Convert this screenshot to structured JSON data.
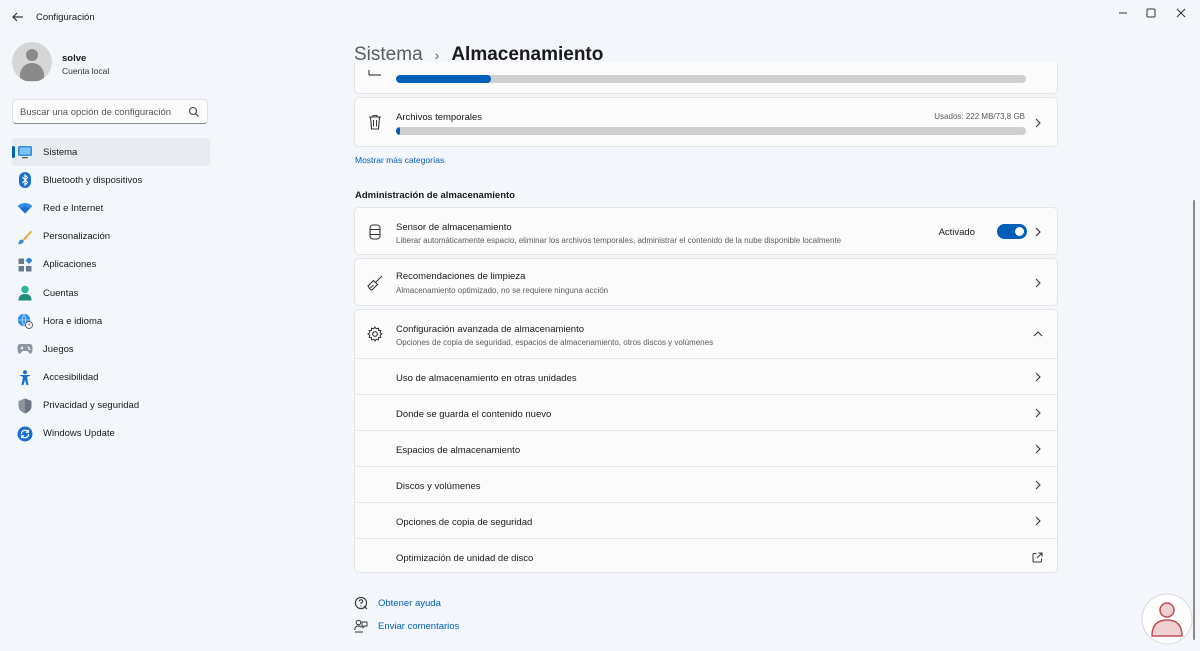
{
  "window": {
    "title": "Configuración",
    "back_icon": "arrow-left-icon"
  },
  "profile": {
    "name": "solve",
    "account_type": "Cuenta local"
  },
  "search": {
    "placeholder": "Buscar una opción de configuración"
  },
  "sidebar": {
    "items": [
      {
        "label": "Sistema",
        "icon": "monitor-icon",
        "active": true
      },
      {
        "label": "Bluetooth y dispositivos",
        "icon": "bluetooth-icon"
      },
      {
        "label": "Red e Internet",
        "icon": "wifi-icon"
      },
      {
        "label": "Personalización",
        "icon": "brush-icon"
      },
      {
        "label": "Aplicaciones",
        "icon": "apps-icon"
      },
      {
        "label": "Cuentas",
        "icon": "person-icon"
      },
      {
        "label": "Hora e idioma",
        "icon": "globe-clock-icon"
      },
      {
        "label": "Juegos",
        "icon": "gamepad-icon"
      },
      {
        "label": "Accesibilidad",
        "icon": "accessibility-icon"
      },
      {
        "label": "Privacidad y seguridad",
        "icon": "shield-icon"
      },
      {
        "label": "Windows Update",
        "icon": "update-icon"
      }
    ]
  },
  "breadcrumb": {
    "parent": "Sistema",
    "separator": "›",
    "current": "Almacenamiento"
  },
  "storage_categories": {
    "partial_item_fill": 0.15,
    "temp_files": {
      "title": "Archivos temporales",
      "usage": "Usados: 222 MB/73,8 GB",
      "fill": 0.003
    },
    "show_more": "Mostrar más categorías"
  },
  "management": {
    "section_title": "Administración de almacenamiento",
    "storage_sense": {
      "title": "Sensor de almacenamiento",
      "subtitle": "Liberar automáticamente espacio, eliminar los archivos temporales, administrar el contenido de la nube disponible localmente",
      "state_label": "Activado",
      "enabled": true
    },
    "cleanup": {
      "title": "Recomendaciones de limpieza",
      "subtitle": "Almacenamiento optimizado, no se requiere ninguna acción"
    },
    "advanced": {
      "title": "Configuración avanzada de almacenamiento",
      "subtitle": "Opciones de copia de seguridad, espacios de almacenamiento, otros discos y volúmenes",
      "items": [
        {
          "label": "Uso de almacenamiento en otras unidades",
          "icon": "chevron-right-icon"
        },
        {
          "label": "Donde se guarda el contenido nuevo",
          "icon": "chevron-right-icon"
        },
        {
          "label": "Espacios de almacenamiento",
          "icon": "chevron-right-icon"
        },
        {
          "label": "Discos y volúmenes",
          "icon": "chevron-right-icon"
        },
        {
          "label": "Opciones de copia de seguridad",
          "icon": "chevron-right-icon"
        },
        {
          "label": "Optimización de unidad de disco",
          "icon": "external-link-icon"
        }
      ]
    }
  },
  "footer": {
    "help": "Obtener ayuda",
    "feedback": "Enviar comentarios"
  },
  "colors": {
    "accent": "#005fb8",
    "card": "#fbfbfb",
    "background": "#f3f6fa"
  }
}
